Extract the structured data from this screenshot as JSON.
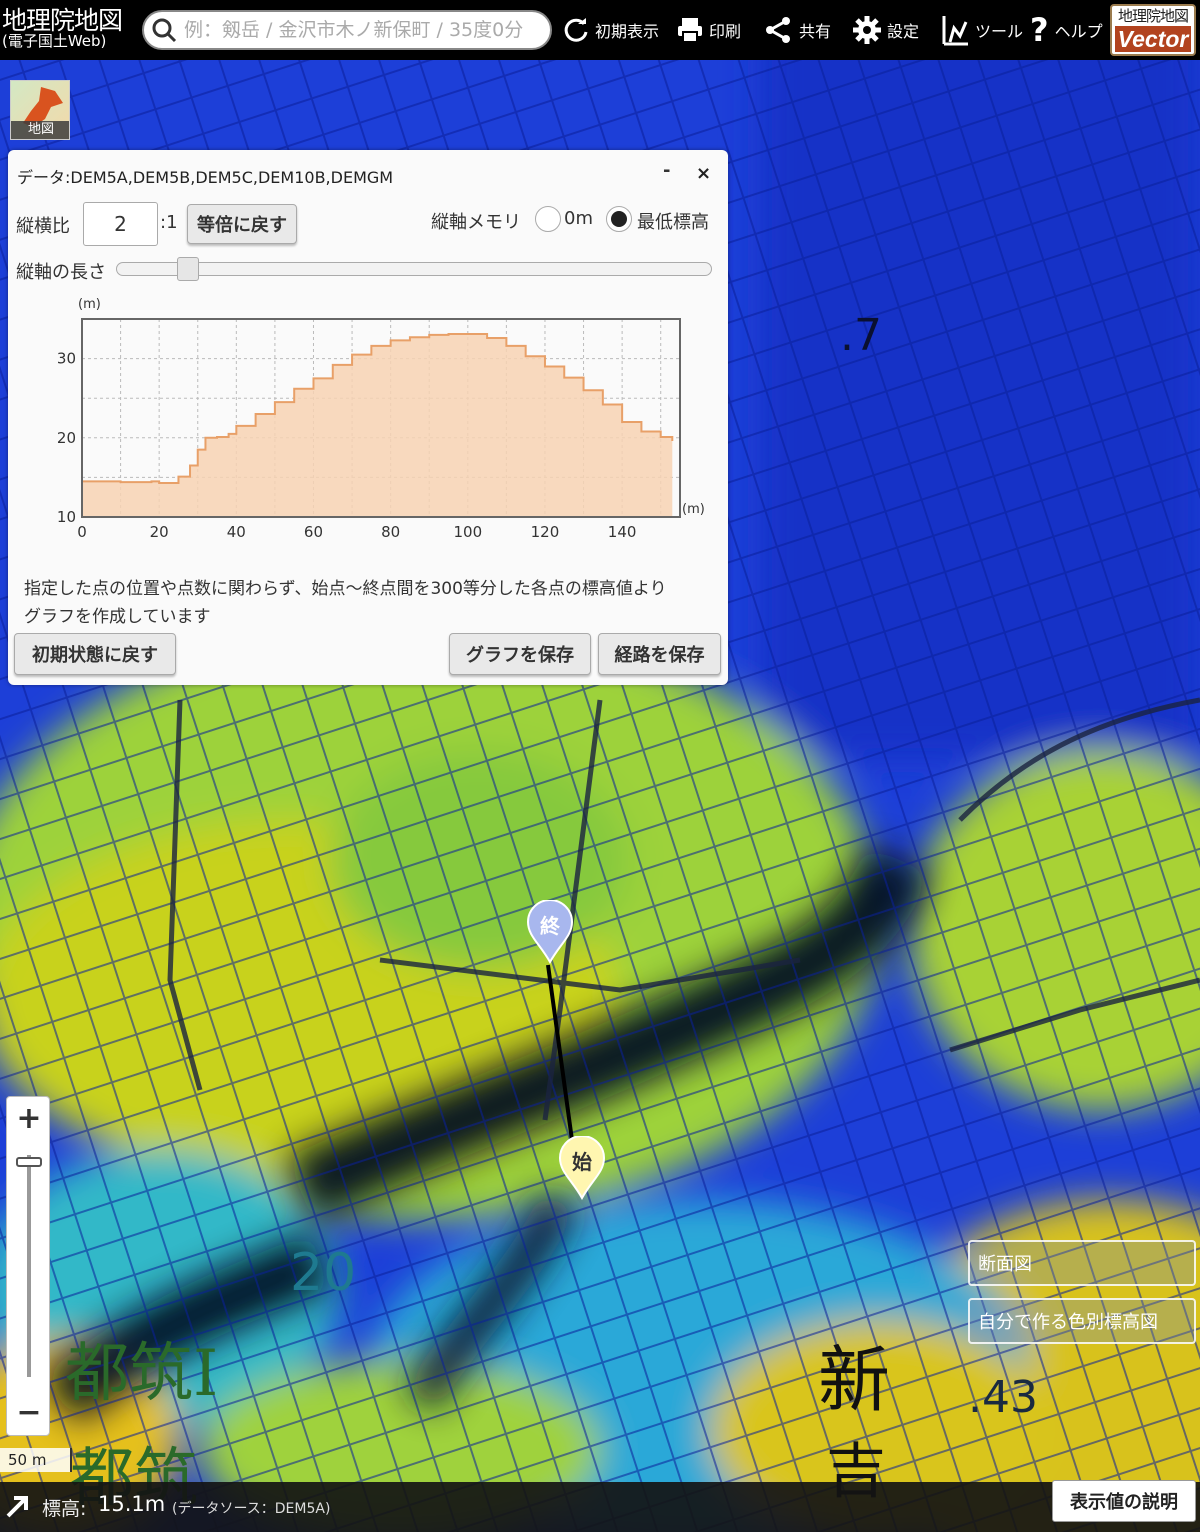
{
  "app": {
    "brand_line1": "地理院地図",
    "brand_line2": "(電子国土Web)",
    "search_placeholder": "例：剱岳 / 金沢市木ノ新保町 / 35度0分",
    "vector_line1": "地理院地図",
    "vector_line2": "Vector"
  },
  "toolbar": [
    {
      "label": "初期表示",
      "icon": "reset-icon"
    },
    {
      "label": "印刷",
      "icon": "printer-icon"
    },
    {
      "label": "共有",
      "icon": "share-icon"
    },
    {
      "label": "設定",
      "icon": "gear-icon"
    },
    {
      "label": "ツール",
      "icon": "tool-icon"
    },
    {
      "label": "ヘルプ",
      "icon": "help-icon"
    }
  ],
  "map_thumb_label": "地図",
  "panel": {
    "data_source": "データ:DEM5A,DEM5B,DEM5C,DEM10B,DEMGM",
    "minimize": "-",
    "close": "×",
    "ratio_label": "縦横比",
    "ratio_value": "2",
    "ratio_suffix": ":1",
    "reset_ratio_btn": "等倍に戻す",
    "axis_memory_label": "縦軸メモリ",
    "radio_0m": "0m",
    "radio_min": "最低標高",
    "radio_selected": "最低標高",
    "axis_length_label": "縦軸の長さ",
    "axis_length_fraction": 0.12,
    "note_line1": "指定した点の位置や点数に関わらず、始点〜終点間を300等分した各点の標高値より",
    "note_line2": "グラフを作成しています",
    "reset_btn": "初期状態に戻す",
    "save_graph_btn": "グラフを保存",
    "save_route_btn": "経路を保存"
  },
  "chart_data": {
    "type": "area",
    "x_unit": "(m)",
    "y_unit": "(m)",
    "xlim": [
      0,
      155
    ],
    "ylim": [
      10,
      35
    ],
    "xticks": [
      "0",
      "20",
      "40",
      "60",
      "80",
      "100",
      "120",
      "140"
    ],
    "yticks": [
      "10",
      "20",
      "30"
    ],
    "grid": true,
    "fill_color": "#f7d2b3",
    "line_color": "#e8a068",
    "x": [
      0,
      5,
      10,
      15,
      18,
      20,
      25,
      28,
      30,
      32,
      35,
      38,
      40,
      45,
      50,
      55,
      60,
      65,
      70,
      75,
      80,
      85,
      90,
      95,
      100,
      105,
      110,
      115,
      120,
      125,
      130,
      135,
      140,
      145,
      150,
      153
    ],
    "y": [
      14.5,
      14.5,
      14.4,
      14.4,
      14.5,
      14.3,
      15.1,
      16.5,
      18.5,
      20.0,
      20.1,
      20.5,
      21.5,
      23.0,
      24.5,
      26.2,
      27.5,
      29.2,
      30.5,
      31.6,
      32.3,
      32.7,
      33.0,
      33.1,
      33.1,
      32.6,
      31.6,
      30.3,
      29.0,
      27.6,
      26.0,
      24.2,
      22.0,
      20.8,
      20.1,
      19.6
    ]
  },
  "zoom": {
    "plus": "+",
    "minus": "−"
  },
  "scale_label": "50 m",
  "side_buttons": [
    "断面図",
    "自分で作る色別標高図"
  ],
  "map_labels": {
    "end_marker": "終",
    "start_marker": "始",
    "elev_7": ".7",
    "elev_43": ".43",
    "contour_20": "20",
    "place_tsuzuki1": "都筑Ⅰ",
    "place_tsuzuki2": "都筑",
    "place_shin": "新",
    "place_yoshi": "吉"
  },
  "status": {
    "elevation_label": "標高:",
    "elevation_value": "15.1m",
    "source": "(データソース：DEM5A)",
    "explain_btn": "表示値の説明"
  }
}
